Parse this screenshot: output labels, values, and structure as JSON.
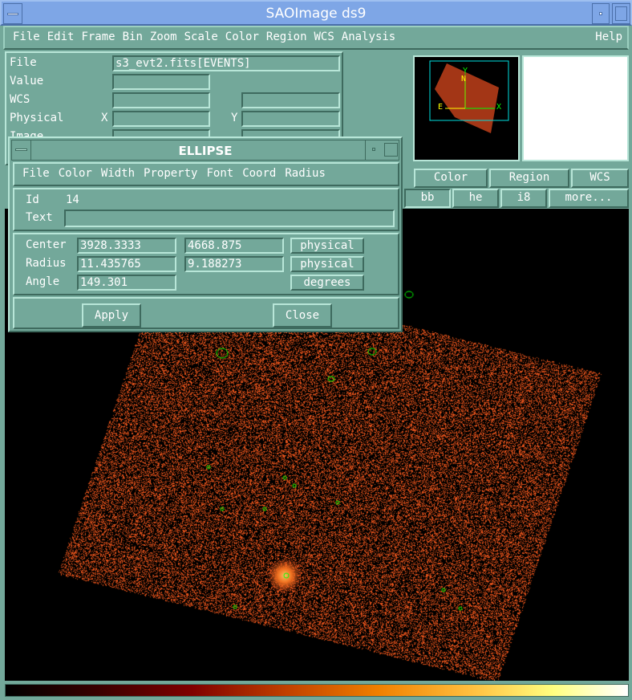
{
  "window": {
    "title": "SAOImage ds9"
  },
  "menu": [
    "File",
    "Edit",
    "Frame",
    "Bin",
    "Zoom",
    "Scale",
    "Color",
    "Region",
    "WCS",
    "Analysis"
  ],
  "help": "Help",
  "info": {
    "file_label": "File",
    "file_value": "s3_evt2.fits[EVENTS]",
    "value_label": "Value",
    "wcs_label": "WCS",
    "physical_label": "Physical",
    "image_label": "Image",
    "x": "X",
    "y": "Y"
  },
  "buttons_row1": [
    "Color",
    "Region",
    "WCS"
  ],
  "buttons_row2": [
    "bb",
    "he",
    "i8",
    "more..."
  ],
  "dialog": {
    "title": "ELLIPSE",
    "menu": [
      "File",
      "Color",
      "Width",
      "Property",
      "Font",
      "Coord",
      "Radius"
    ],
    "id_label": "Id",
    "id_value": "14",
    "text_label": "Text",
    "text_value": "",
    "center_label": "Center",
    "center_x": "3928.3333",
    "center_y": "4668.875",
    "center_unit": "physical",
    "radius_label": "Radius",
    "radius_x": "11.435765",
    "radius_y": "9.188273",
    "radius_unit": "physical",
    "angle_label": "Angle",
    "angle_value": "149.301",
    "angle_unit": "degrees",
    "apply": "Apply",
    "close": "Close"
  },
  "panner": {
    "n": "N",
    "e": "E",
    "x": "X",
    "y": "Y"
  },
  "colors": {
    "title": "#7ea6e6",
    "bg": "#73a89a",
    "events": "#e0501a",
    "region": "#00ff00"
  }
}
